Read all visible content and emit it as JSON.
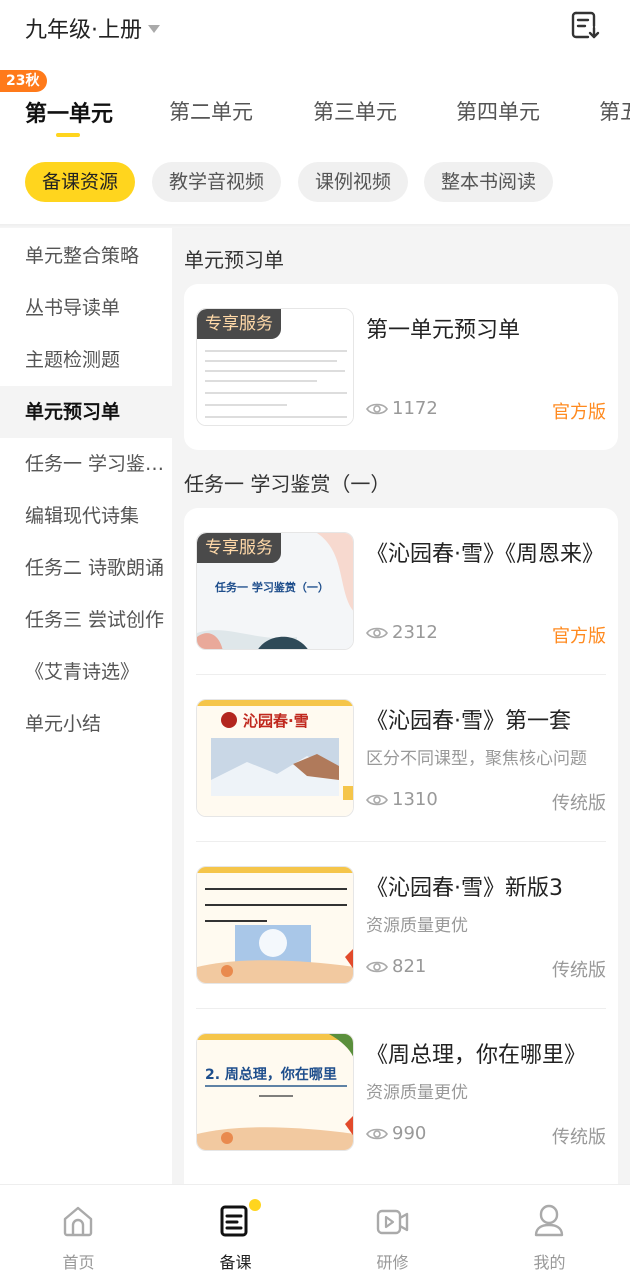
{
  "header": {
    "grade_label": "九年级·上册",
    "doc_icon": "document-download-icon"
  },
  "unit_tabs": {
    "badge": "23秋",
    "items": [
      "第一单元",
      "第二单元",
      "第三单元",
      "第四单元",
      "第五"
    ]
  },
  "chips": [
    "备课资源",
    "教学音视频",
    "课例视频",
    "整本书阅读"
  ],
  "sidebar": {
    "items": [
      "单元整合策略",
      "丛书导读单",
      "主题检测题",
      "单元预习单",
      "任务一 学习鉴赏（一）",
      "编辑现代诗集",
      "任务二 诗歌朗诵",
      "任务三 尝试创作",
      "《艾青诗选》",
      "单元小结"
    ]
  },
  "sections": [
    {
      "title": "单元预习单",
      "items": [
        {
          "title": "第一单元预习单",
          "subtitle": "",
          "views": "1172",
          "badge": "官方版",
          "tag": "专享服务"
        }
      ]
    },
    {
      "title": "任务一 学习鉴赏（一）",
      "items": [
        {
          "title": "《沁园春·雪》《周恩来》",
          "subtitle": "",
          "views": "2312",
          "badge": "官方版",
          "tag": "专享服务",
          "thumb_text": "任务一  学习鉴赏（一）"
        },
        {
          "title": "《沁园春·雪》第一套",
          "subtitle": "区分不同课型，聚焦核心问题",
          "views": "1310",
          "badge": "传统版",
          "thumb_text": "沁园春·雪"
        },
        {
          "title": "《沁园春·雪》新版3",
          "subtitle": "资源质量更优",
          "views": "821",
          "badge": "传统版"
        },
        {
          "title": "《周总理，你在哪里》",
          "subtitle": "资源质量更优",
          "views": "990",
          "badge": "传统版",
          "thumb_text": "2. 周总理，你在哪里"
        }
      ]
    }
  ],
  "bottom_nav": [
    {
      "label": "首页",
      "icon": "home-icon"
    },
    {
      "label": "备课",
      "icon": "lesson-prep-icon"
    },
    {
      "label": "研修",
      "icon": "video-training-icon"
    },
    {
      "label": "我的",
      "icon": "profile-icon"
    }
  ],
  "colors": {
    "accent": "#ffd51e",
    "official": "#ff8a1f",
    "badge": "#ff7a1a"
  }
}
